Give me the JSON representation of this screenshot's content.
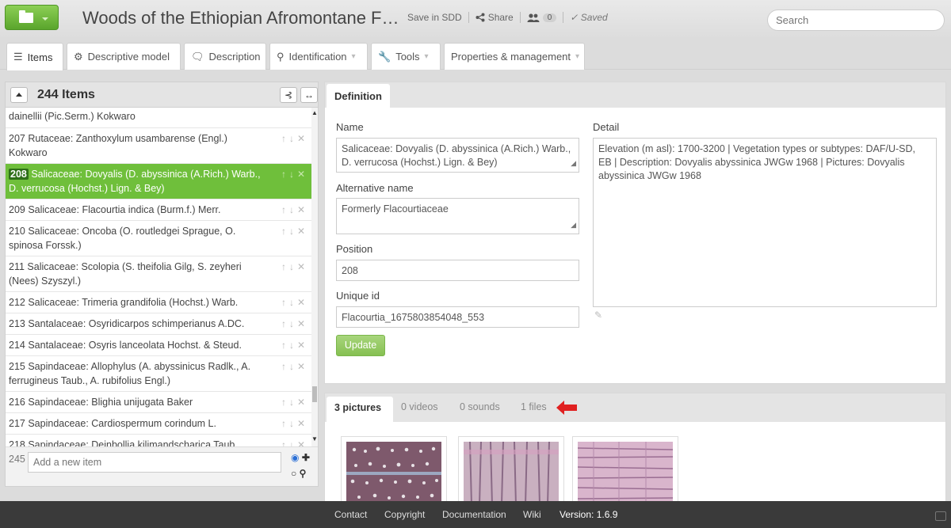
{
  "header": {
    "title": "Woods of the Ethiopian Afromontane F…",
    "save_sdd": "Save in SDD",
    "share": "Share",
    "share_icon": "share-icon",
    "users_count": "0",
    "saved": "Saved",
    "search_placeholder": "Search"
  },
  "tabs": [
    {
      "label": "Items",
      "icon": "list-icon"
    },
    {
      "label": "Descriptive model",
      "icon": "gears-icon"
    },
    {
      "label": "Description",
      "icon": "comment-icon"
    },
    {
      "label": "Identification",
      "icon": "search-icon"
    },
    {
      "label": "Tools",
      "icon": "wrench-icon"
    },
    {
      "label": "Properties & management"
    }
  ],
  "items_panel": {
    "count": "244 Items",
    "rows": [
      {
        "num": "",
        "text": "dainellii (Pic.Serm.) Kokwaro",
        "selected": false
      },
      {
        "num": "207",
        "text": "Rutaceae: Zanthoxylum usambarense (Engl.) Kokwaro",
        "selected": false
      },
      {
        "num": "208",
        "text": "Salicaceae: Dovyalis (D. abyssinica (A.Rich.) Warb., D. verrucosa (Hochst.) Lign. & Bey)",
        "selected": true
      },
      {
        "num": "209",
        "text": "Salicaceae: Flacourtia indica (Burm.f.) Merr.",
        "selected": false
      },
      {
        "num": "210",
        "text": "Salicaceae: Oncoba (O. routledgei Sprague, O. spinosa Forssk.)",
        "selected": false
      },
      {
        "num": "211",
        "text": "Salicaceae: Scolopia (S. theifolia Gilg, S. zeyheri (Nees) Szyszyl.)",
        "selected": false
      },
      {
        "num": "212",
        "text": "Salicaceae: Trimeria grandifolia (Hochst.) Warb.",
        "selected": false
      },
      {
        "num": "213",
        "text": "Santalaceae: Osyridicarpos schimperianus A.DC.",
        "selected": false
      },
      {
        "num": "214",
        "text": "Santalaceae: Osyris lanceolata Hochst. & Steud.",
        "selected": false
      },
      {
        "num": "215",
        "text": "Sapindaceae: Allophylus (A. abyssinicus Radlk., A. ferrugineus Taub., A. rubifolius Engl.)",
        "selected": false
      },
      {
        "num": "216",
        "text": "Sapindaceae: Blighia unijugata Baker",
        "selected": false
      },
      {
        "num": "217",
        "text": "Sapindaceae: Cardiospermum corindum L.",
        "selected": false
      },
      {
        "num": "218",
        "text": "Sapindaceae: Deinbollia kilimandscharica Taub.",
        "selected": false
      }
    ],
    "new_num": "245",
    "new_placeholder": "Add a new item"
  },
  "definition": {
    "tab_label": "Definition",
    "name_label": "Name",
    "name_value": "Salicaceae: Dovyalis (D. abyssinica (A.Rich.) Warb., D. verrucosa (Hochst.) Lign. & Bey)",
    "alt_label": "Alternative name",
    "alt_value": "Formerly Flacourtiaceae",
    "position_label": "Position",
    "position_value": "208",
    "uid_label": "Unique id",
    "uid_value": "Flacourtia_1675803854048_553",
    "update_label": "Update",
    "detail_label": "Detail",
    "detail_value": "Elevation (m asl): 1700-3200 | Vegetation types or subtypes: DAF/U-SD, EB | Description: Dovyalis abyssinica JWGw 1968 | Pictures: Dovyalis abyssinica JWGw 1968"
  },
  "media": {
    "pictures": "3 pictures",
    "videos": "0 videos",
    "sounds": "0 sounds",
    "files": "1 files",
    "arrow_color": "#e02020"
  },
  "footer": {
    "contact": "Contact",
    "copyright": "Copyright",
    "documentation": "Documentation",
    "wiki": "Wiki",
    "version": "Version: 1.6.9"
  },
  "colors": {
    "accent": "#6fbf3b",
    "footer": "#3a3a3a"
  }
}
